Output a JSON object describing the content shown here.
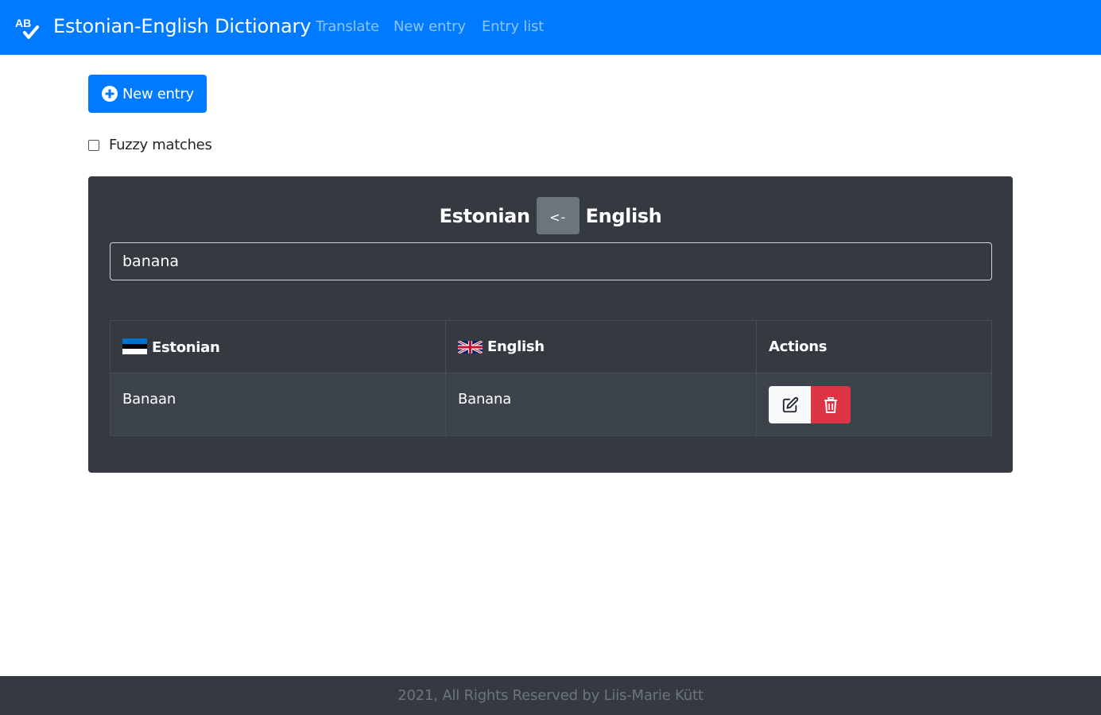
{
  "navbar": {
    "logo_text": "AB",
    "title": "Estonian-English Dictionary",
    "links": [
      "Translate",
      "New entry",
      "Entry list"
    ],
    "color": "#007bff"
  },
  "new_entry_button": {
    "label": "New entry",
    "icon": "plus-circle-icon"
  },
  "fuzzy": {
    "label": "Fuzzy matches",
    "checked": false
  },
  "translator": {
    "source_language": "Estonian",
    "swap_label": "<-",
    "target_language": "English",
    "search_value": "banana"
  },
  "table": {
    "headers": {
      "estonian": "Estonian",
      "english": "English",
      "actions": "Actions"
    },
    "rows": [
      {
        "estonian": "Banaan",
        "english": "Banana"
      }
    ]
  },
  "footer": {
    "text": "2021, All Rights Reserved by Liis-Marie Kütt"
  },
  "colors": {
    "primary": "#007bff",
    "dark": "#343a40",
    "danger": "#dc3545",
    "secondary": "#6c757d"
  }
}
